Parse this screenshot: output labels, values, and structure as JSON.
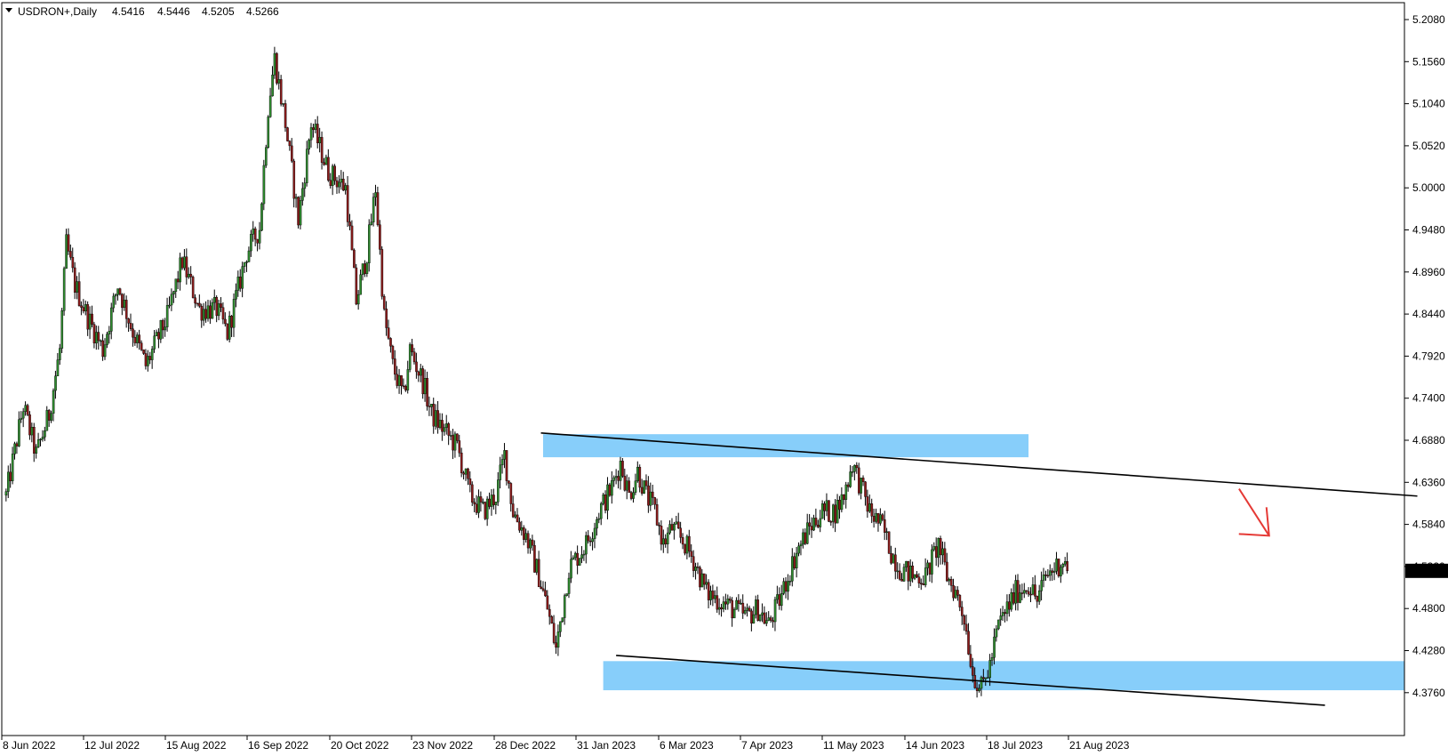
{
  "header": {
    "symbol": "USDRON+,Daily",
    "open": "4.5416",
    "high": "4.5446",
    "low": "4.5205",
    "close": "4.5266"
  },
  "colors": {
    "bull": "#2e8b2e",
    "bear": "#8b1a1a",
    "zone": "#87cefa",
    "trendline": "#000000",
    "arrow": "#e53935",
    "price_tag_bg": "#000000",
    "price_tag_fg": "#ffffff"
  },
  "chart_data": {
    "type": "candlestick",
    "ylim": [
      4.35,
      5.21
    ],
    "y_ticks": [
      "5.2080",
      "5.1560",
      "5.1040",
      "5.0520",
      "5.0000",
      "4.9480",
      "4.8960",
      "4.8440",
      "4.7920",
      "4.7400",
      "4.6880",
      "4.6360",
      "4.5840",
      "4.5320",
      "4.4800",
      "4.4280",
      "4.3760"
    ],
    "x_ticks": [
      "8 Jun 2022",
      "12 Jul 2022",
      "15 Aug 2022",
      "16 Sep 2022",
      "20 Oct 2022",
      "23 Nov 2022",
      "28 Dec 2022",
      "31 Jan 2023",
      "6 Mar 2023",
      "7 Apr 2023",
      "11 May 2023",
      "14 Jun 2023",
      "18 Jul 2023",
      "21 Aug 2023"
    ],
    "current_price": "4.5266",
    "grid": false,
    "path": [
      [
        0,
        4.62
      ],
      [
        8,
        4.73
      ],
      [
        14,
        4.67
      ],
      [
        20,
        4.72
      ],
      [
        25,
        4.8
      ],
      [
        28,
        4.93
      ],
      [
        32,
        4.88
      ],
      [
        38,
        4.84
      ],
      [
        45,
        4.8
      ],
      [
        52,
        4.88
      ],
      [
        58,
        4.83
      ],
      [
        65,
        4.78
      ],
      [
        75,
        4.84
      ],
      [
        82,
        4.91
      ],
      [
        90,
        4.85
      ],
      [
        98,
        4.85
      ],
      [
        103,
        4.82
      ],
      [
        112,
        4.92
      ],
      [
        118,
        4.95
      ],
      [
        122,
        5.1
      ],
      [
        125,
        5.16
      ],
      [
        130,
        5.08
      ],
      [
        136,
        4.96
      ],
      [
        142,
        5.08
      ],
      [
        150,
        5.02
      ],
      [
        158,
        5.0
      ],
      [
        163,
        4.86
      ],
      [
        168,
        4.92
      ],
      [
        172,
        5.0
      ],
      [
        176,
        4.84
      ],
      [
        180,
        4.78
      ],
      [
        185,
        4.74
      ],
      [
        188,
        4.8
      ],
      [
        194,
        4.76
      ],
      [
        198,
        4.72
      ],
      [
        204,
        4.7
      ],
      [
        210,
        4.68
      ],
      [
        216,
        4.62
      ],
      [
        222,
        4.6
      ],
      [
        228,
        4.62
      ],
      [
        232,
        4.67
      ],
      [
        236,
        4.6
      ],
      [
        242,
        4.57
      ],
      [
        248,
        4.52
      ],
      [
        252,
        4.48
      ],
      [
        256,
        4.43
      ],
      [
        262,
        4.53
      ],
      [
        270,
        4.56
      ],
      [
        276,
        4.6
      ],
      [
        282,
        4.63
      ],
      [
        286,
        4.66
      ],
      [
        290,
        4.62
      ],
      [
        294,
        4.65
      ],
      [
        298,
        4.62
      ],
      [
        302,
        4.6
      ],
      [
        306,
        4.56
      ],
      [
        310,
        4.58
      ],
      [
        316,
        4.56
      ],
      [
        320,
        4.54
      ],
      [
        326,
        4.5
      ],
      [
        332,
        4.49
      ],
      [
        338,
        4.48
      ],
      [
        345,
        4.47
      ],
      [
        350,
        4.48
      ],
      [
        355,
        4.46
      ],
      [
        360,
        4.49
      ],
      [
        364,
        4.52
      ],
      [
        368,
        4.55
      ],
      [
        374,
        4.58
      ],
      [
        380,
        4.6
      ],
      [
        386,
        4.6
      ],
      [
        390,
        4.62
      ],
      [
        394,
        4.66
      ],
      [
        398,
        4.63
      ],
      [
        402,
        4.6
      ],
      [
        408,
        4.58
      ],
      [
        412,
        4.55
      ],
      [
        416,
        4.53
      ],
      [
        422,
        4.52
      ],
      [
        428,
        4.52
      ],
      [
        434,
        4.56
      ],
      [
        438,
        4.52
      ],
      [
        442,
        4.5
      ],
      [
        446,
        4.47
      ],
      [
        450,
        4.4
      ],
      [
        454,
        4.38
      ],
      [
        458,
        4.41
      ],
      [
        462,
        4.46
      ],
      [
        466,
        4.48
      ],
      [
        470,
        4.5
      ],
      [
        476,
        4.51
      ],
      [
        480,
        4.49
      ],
      [
        484,
        4.52
      ],
      [
        488,
        4.53
      ],
      [
        492,
        4.54
      ],
      [
        494,
        4.53
      ]
    ],
    "zones": [
      {
        "d0": 250,
        "d1": 476,
        "p0": 4.6955,
        "p1": 4.667
      },
      {
        "d0": 278,
        "d1": 725,
        "p0": 4.415,
        "p1": 4.379
      }
    ],
    "trendlines": [
      {
        "d0": 249,
        "p0": 4.697,
        "d1": 657,
        "p1": 4.619
      },
      {
        "d0": 284,
        "p0": 4.422,
        "d1": 614,
        "p1": 4.3605
      }
    ],
    "arrow": {
      "d0": 574,
      "p0": 4.628,
      "d1": 588,
      "p1": 4.57
    },
    "x_domain": [
      -2,
      651
    ]
  }
}
